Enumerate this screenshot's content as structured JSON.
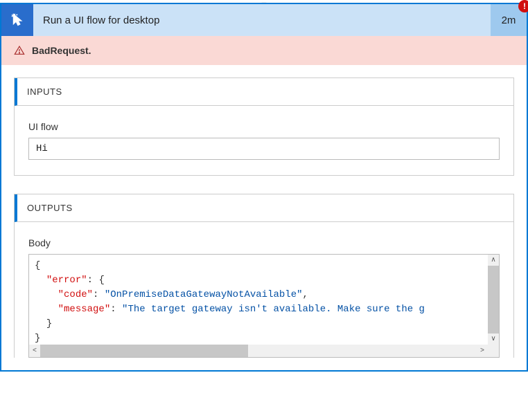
{
  "header": {
    "title": "Run a UI flow for desktop",
    "duration": "2m",
    "error_badge_glyph": "!"
  },
  "error_banner": {
    "text": "BadRequest."
  },
  "inputs_panel": {
    "title": "INPUTS",
    "fields": {
      "ui_flow": {
        "label": "UI flow",
        "value": "Hi"
      }
    }
  },
  "outputs_panel": {
    "title": "OUTPUTS",
    "body_label": "Body",
    "body_json": {
      "error": {
        "code": "OnPremiseDataGatewayNotAvailable",
        "message": "The target gateway isn't available. Make sure the g"
      }
    }
  }
}
